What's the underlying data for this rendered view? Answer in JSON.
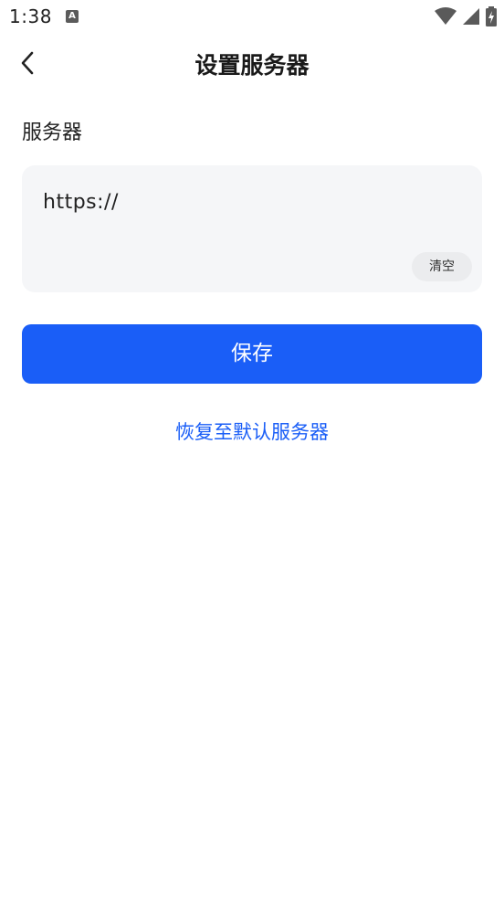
{
  "status_bar": {
    "time": "1:38",
    "notification_icon_letter": "A",
    "icons": [
      "wifi-icon",
      "cellular-signal-icon",
      "battery-charging-icon"
    ]
  },
  "header": {
    "title": "设置服务器",
    "back_icon": "chevron-left-icon"
  },
  "form": {
    "section_label": "服务器",
    "server_value": "https://",
    "clear_label": "清空"
  },
  "actions": {
    "save_label": "保存",
    "restore_label": "恢复至默认服务器"
  },
  "colors": {
    "accent": "#1a5ef7",
    "input_background": "#f5f6f8",
    "clear_button_background": "#ebecee"
  }
}
